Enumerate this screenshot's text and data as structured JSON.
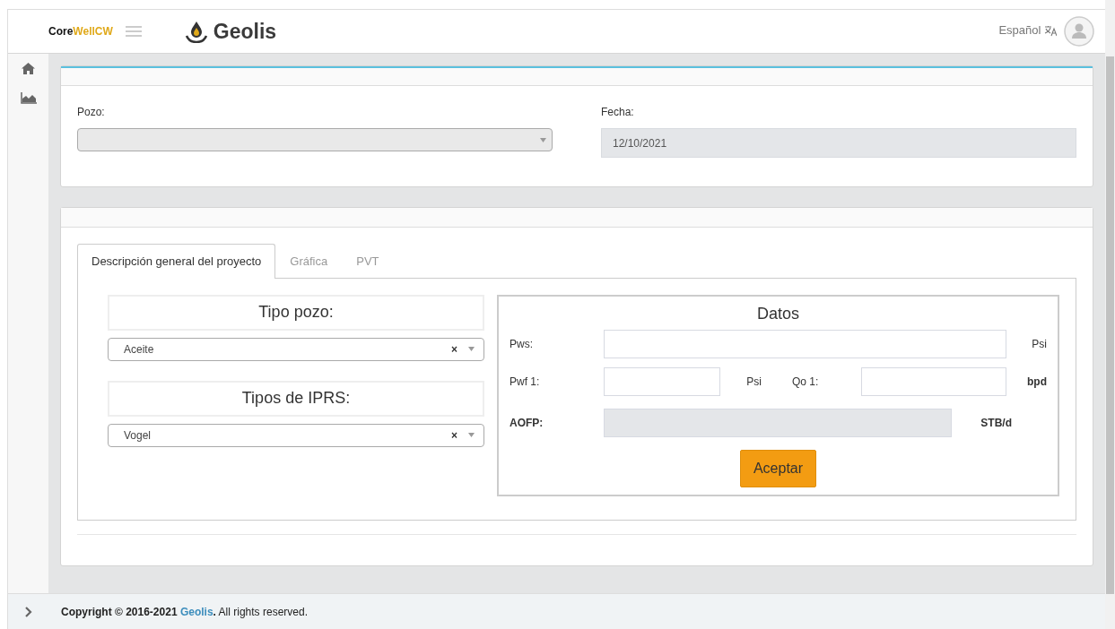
{
  "header": {
    "brand_prefix": "Core",
    "brand_suffix": "WellCW",
    "logo_text": "Geolis",
    "language": "Español"
  },
  "sidebar": {
    "items": [
      {
        "kind": "home"
      },
      {
        "kind": "chart"
      }
    ]
  },
  "filters": {
    "pozo": {
      "label": "Pozo:"
    },
    "fecha": {
      "label": "Fecha:",
      "value": "12/10/2021",
      "disabled": true
    }
  },
  "tabs": [
    {
      "label": "Descripción general del proyecto",
      "selected": true
    },
    {
      "label": "Gráfica",
      "selected": false
    },
    {
      "label": "PVT",
      "selected": false
    }
  ],
  "tipo_pozo": {
    "title": "Tipo pozo:",
    "value": "Aceite",
    "clear": "×"
  },
  "tipos_iprs": {
    "title": "Tipos de IPRS:",
    "value": "Vogel",
    "clear": "×"
  },
  "datos": {
    "title": "Datos",
    "pws": {
      "label": "Pws:",
      "unit": "Psi"
    },
    "pwf": {
      "label": "Pwf 1:",
      "unit": "Psi"
    },
    "qo": {
      "label": "Qo 1:",
      "unit": "bpd"
    },
    "aofp": {
      "label": "AOFP:",
      "unit": "STB/d",
      "disabled": true
    },
    "button": "Aceptar"
  },
  "footer": {
    "prefix": "**Copyright © 2016-2021** ",
    "link": "Geolis",
    "suffix": "**.** All rights reserved."
  }
}
